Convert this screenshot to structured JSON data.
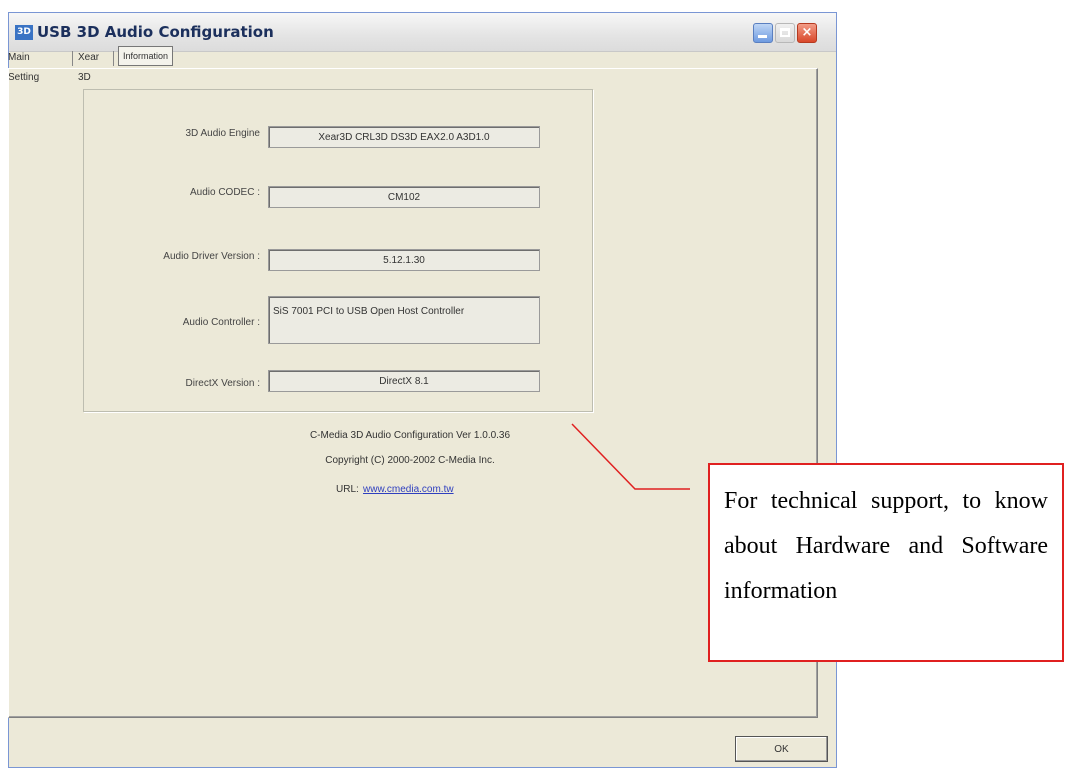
{
  "window": {
    "title": "USB 3D Audio Configuration",
    "icon_text": "3D",
    "controls": {
      "minimize": "",
      "maximize": "",
      "close": "×"
    }
  },
  "tabs": [
    {
      "label": "Main Setting",
      "selected": false
    },
    {
      "label": "Xear 3D",
      "selected": false
    },
    {
      "label": "Information",
      "selected": true
    }
  ],
  "info": {
    "engine_label": "3D Audio Engine",
    "engine_value": "Xear3D  CRL3D  DS3D  EAX2.0  A3D1.0",
    "codec_label": "Audio CODEC :",
    "codec_value": "CM102",
    "driver_label": "Audio Driver Version :",
    "driver_value": "5.12.1.30",
    "controller_label": "Audio Controller :",
    "controller_value": "SiS 7001 PCI to USB Open Host Controller",
    "directx_label": "DirectX Version :",
    "directx_value": "DirectX 8.1"
  },
  "footer": {
    "config_version": "C-Media 3D Audio Configuration Ver 1.0.0.36",
    "copyright": "Copyright (C) 2000-2002 C-Media Inc.",
    "url_label": "URL:",
    "url_value": "www.cmedia.com.tw"
  },
  "ok_label": "OK",
  "callout": {
    "text": "For technical support, to know about Hardware and Software information",
    "border_color": "#e02020"
  },
  "colors": {
    "dialog_bg": "#ece9d8",
    "link": "#2f3fbf"
  }
}
